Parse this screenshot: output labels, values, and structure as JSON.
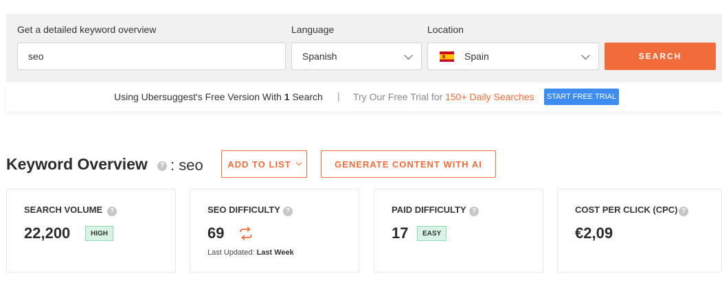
{
  "search": {
    "keyword_label": "Get a detailed keyword overview",
    "keyword_value": "seo",
    "language_label": "Language",
    "language_value": "Spanish",
    "location_label": "Location",
    "location_value": "Spain",
    "search_button": "SEARCH",
    "flag_icon": "spain-flag-icon"
  },
  "banner": {
    "free_version_prefix": "Using Ubersuggest's Free Version With",
    "free_version_count": "1",
    "free_version_suffix": "Search",
    "separator": "|",
    "trial_prefix": "Try Our Free Trial for",
    "trial_highlight": "150+ Daily Searches",
    "trial_button": "START FREE TRIAL"
  },
  "overview": {
    "title": "Keyword Overview",
    "keyword_sep": ":",
    "keyword": "seo",
    "add_to_list": "ADD TO LIST",
    "generate_content": "GENERATE CONTENT WITH AI"
  },
  "cards": [
    {
      "label": "SEARCH VOLUME",
      "value": "22,200",
      "badge": "HIGH"
    },
    {
      "label": "SEO DIFFICULTY",
      "value": "69",
      "updated_prefix": "Last Updated:",
      "updated_value": "Last Week"
    },
    {
      "label": "PAID DIFFICULTY",
      "value": "17",
      "badge": "EASY"
    },
    {
      "label": "COST PER CLICK (CPC)",
      "value": "€2,09"
    }
  ],
  "colors": {
    "accent_orange": "#f26b3a",
    "trial_blue": "#3d8cf0",
    "badge_green_bg": "#d8f3e6"
  }
}
